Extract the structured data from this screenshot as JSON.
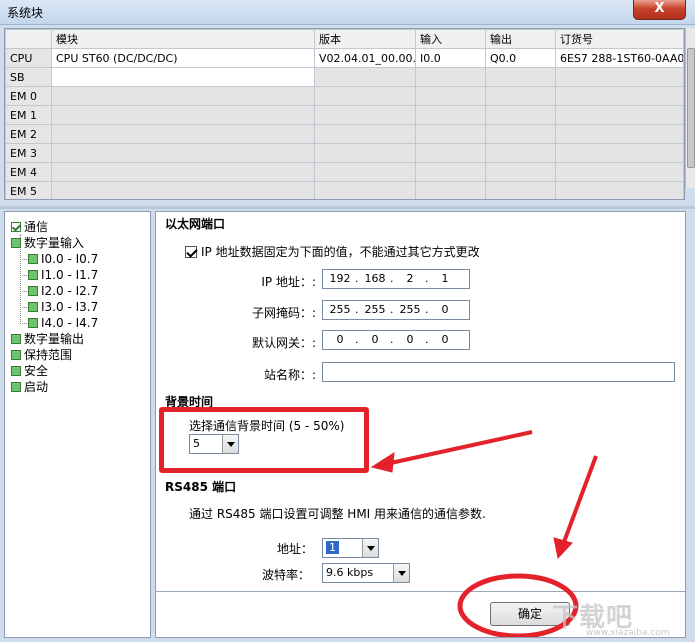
{
  "window": {
    "title": "系统块",
    "close_symbol": "X"
  },
  "grid": {
    "headers": [
      "",
      "模块",
      "版本",
      "输入",
      "输出",
      "订货号"
    ],
    "rows": [
      {
        "slot": "CPU",
        "module": "CPU ST60 (DC/DC/DC)",
        "version": "V02.04.01_00.00...",
        "input": "I0.0",
        "output": "Q0.0",
        "order": "6ES7 288-1ST60-0AA0"
      },
      {
        "slot": "SB",
        "module": "",
        "version": "",
        "input": "",
        "output": "",
        "order": ""
      },
      {
        "slot": "EM 0",
        "module": "",
        "version": "",
        "input": "",
        "output": "",
        "order": ""
      },
      {
        "slot": "EM 1",
        "module": "",
        "version": "",
        "input": "",
        "output": "",
        "order": ""
      },
      {
        "slot": "EM 2",
        "module": "",
        "version": "",
        "input": "",
        "output": "",
        "order": ""
      },
      {
        "slot": "EM 3",
        "module": "",
        "version": "",
        "input": "",
        "output": "",
        "order": ""
      },
      {
        "slot": "EM 4",
        "module": "",
        "version": "",
        "input": "",
        "output": "",
        "order": ""
      },
      {
        "slot": "EM 5",
        "module": "",
        "version": "",
        "input": "",
        "output": "",
        "order": ""
      }
    ]
  },
  "tree": {
    "items": [
      {
        "label": "通信",
        "checked": true
      },
      {
        "label": "数字量输入"
      },
      {
        "label": "I0.0 - I0.7"
      },
      {
        "label": "I1.0 - I1.7"
      },
      {
        "label": "I2.0 - I2.7"
      },
      {
        "label": "I3.0 - I3.7"
      },
      {
        "label": "I4.0 - I4.7"
      },
      {
        "label": "数字量输出"
      },
      {
        "label": "保持范围"
      },
      {
        "label": "安全"
      },
      {
        "label": "启动"
      }
    ]
  },
  "ethernet": {
    "section_title": "以太网端口",
    "fixed_ip_label": "IP 地址数据固定为下面的值，不能通过其它方式更改",
    "ip_label": "IP 地址：:",
    "ip": [
      "192",
      "168",
      "2",
      "1"
    ],
    "subnet_label": "子网掩码：:",
    "subnet": [
      "255",
      "255",
      "255",
      "0"
    ],
    "gateway_label": "默认网关：:",
    "gateway": [
      "0",
      "0",
      "0",
      "0"
    ],
    "station_label": "站名称：:",
    "station_value": "",
    "dot": "."
  },
  "background": {
    "section_title": "背景时间",
    "select_label": "选择通信背景时间 (5 - 50%)",
    "value": "5"
  },
  "rs485": {
    "section_title": "RS485 端口",
    "description": "通过 RS485 端口设置可调整 HMI 用来通信的通信参数.",
    "address_label": "地址：",
    "address_value": "1",
    "baud_label": "波特率：",
    "baud_value": "9.6 kbps"
  },
  "footer": {
    "ok_label": "确定"
  },
  "watermark": {
    "text": "下载吧",
    "sub": "www.xiazaiba.com"
  },
  "colors": {
    "annotation_red": "#e3222b",
    "tree_box_green": "#6dc46a"
  }
}
